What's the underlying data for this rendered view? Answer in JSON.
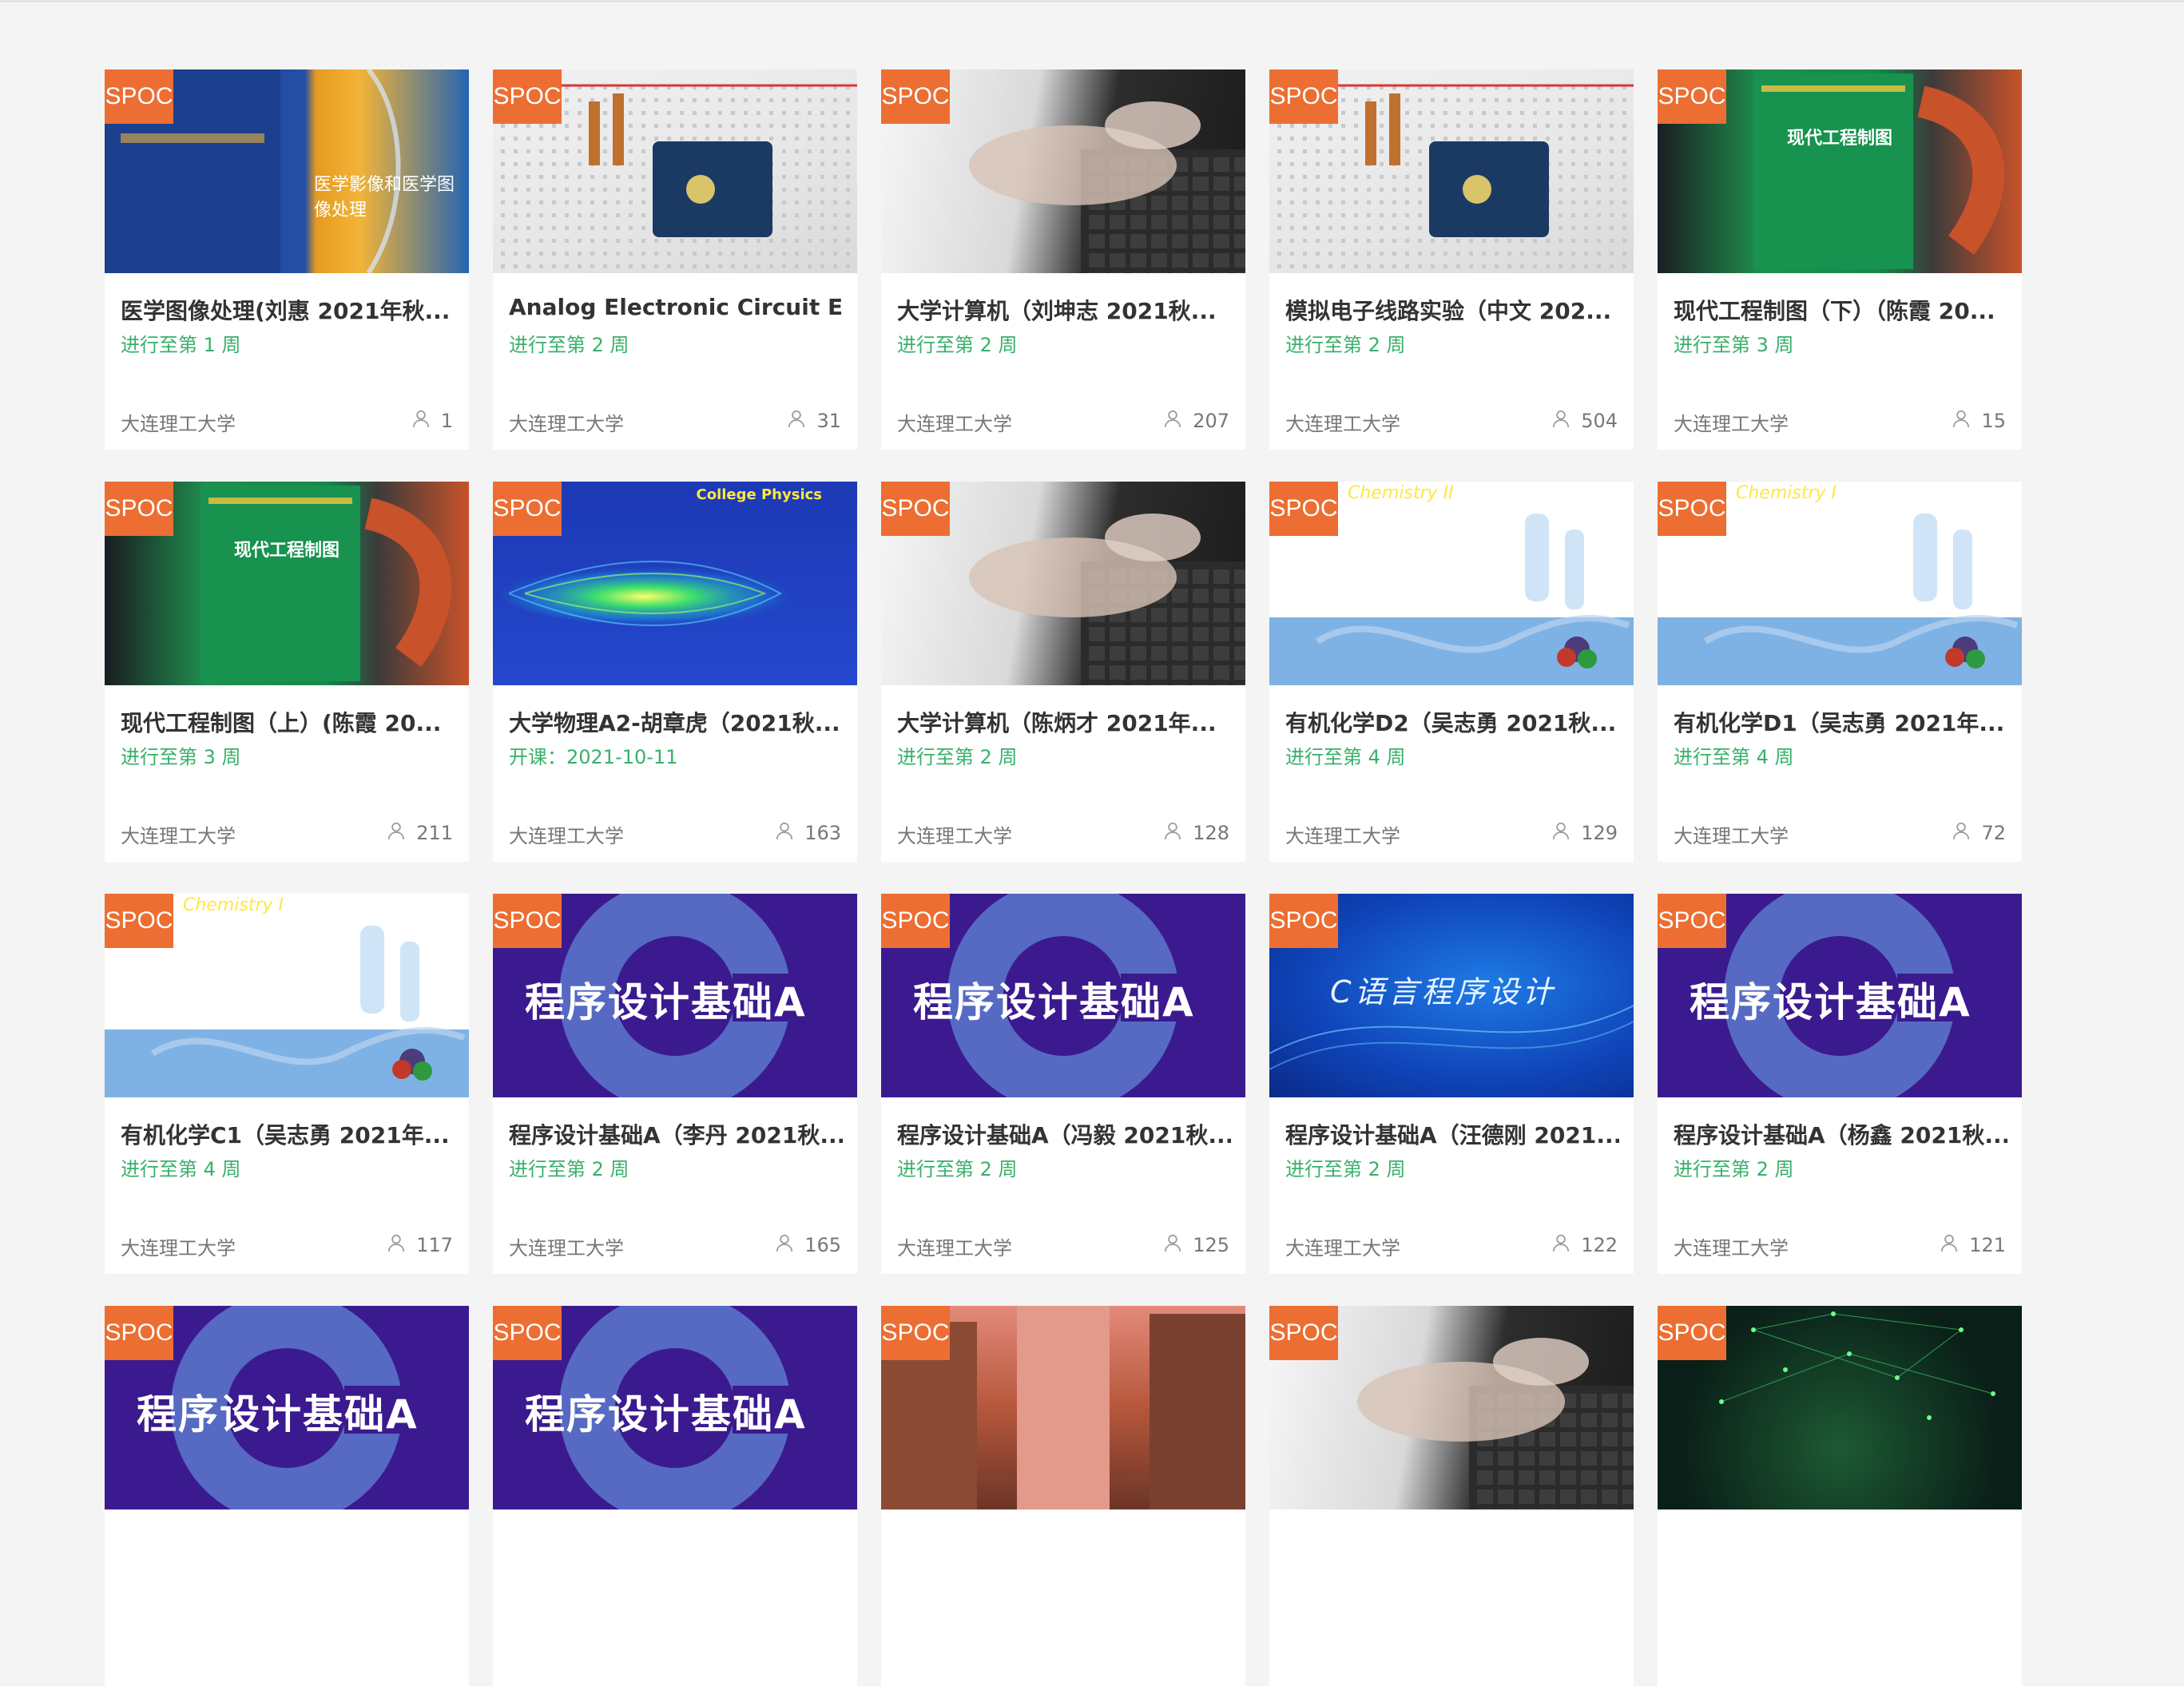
{
  "badge_label": "SPOC",
  "thumb_texts": {
    "physics": "College Physics",
    "chem2": "Chemistry II",
    "chem1": "Chemistry I",
    "cprog": "程序设计基础A",
    "clang": "C语言程序设计",
    "drawing": "现代工程制图",
    "medical": "医学影像和医学图像处理"
  },
  "rows": [
    {
      "cards": [
        {
          "title": "医学图像处理(刘惠 2021年秋...",
          "progress": "进行至第 1 周",
          "school": "大连理工大学",
          "count": "1",
          "theme": "medical"
        },
        {
          "title": "Analog Electronic Circuit E...",
          "progress": "进行至第 2 周",
          "school": "大连理工大学",
          "count": "31",
          "theme": "breadboard"
        },
        {
          "title": "大学计算机（刘坤志 2021秋...",
          "progress": "进行至第 2 周",
          "school": "大连理工大学",
          "count": "207",
          "theme": "keyboard"
        },
        {
          "title": "模拟电子线路实验（中文 202...",
          "progress": "进行至第 2 周",
          "school": "大连理工大学",
          "count": "504",
          "theme": "breadboard"
        },
        {
          "title": "现代工程制图（下）（陈霞 20...",
          "progress": "进行至第 3 周",
          "school": "大连理工大学",
          "count": "15",
          "theme": "drawing"
        }
      ]
    },
    {
      "cards": [
        {
          "title": "现代工程制图（上）(陈霞 20...",
          "progress": "进行至第 3 周",
          "school": "大连理工大学",
          "count": "211",
          "theme": "drawing"
        },
        {
          "title": "大学物理A2-胡章虎（2021秋...",
          "progress": "开课：2021-10-11",
          "school": "大连理工大学",
          "count": "163",
          "theme": "physics"
        },
        {
          "title": "大学计算机（陈炳才 2021年...",
          "progress": "进行至第 2 周",
          "school": "大连理工大学",
          "count": "128",
          "theme": "keyboard"
        },
        {
          "title": "有机化学D2（吴志勇 2021秋...",
          "progress": "进行至第 4 周",
          "school": "大连理工大学",
          "count": "129",
          "theme": "chem2"
        },
        {
          "title": "有机化学D1（吴志勇 2021年...",
          "progress": "进行至第 4 周",
          "school": "大连理工大学",
          "count": "72",
          "theme": "chem1"
        }
      ]
    },
    {
      "cards": [
        {
          "title": "有机化学C1（吴志勇 2021年...",
          "progress": "进行至第 4 周",
          "school": "大连理工大学",
          "count": "117",
          "theme": "chem1"
        },
        {
          "title": "程序设计基础A（李丹 2021秋...",
          "progress": "进行至第 2 周",
          "school": "大连理工大学",
          "count": "165",
          "theme": "cprog"
        },
        {
          "title": "程序设计基础A（冯毅 2021秋...",
          "progress": "进行至第 2 周",
          "school": "大连理工大学",
          "count": "125",
          "theme": "cprog"
        },
        {
          "title": "程序设计基础A（汪德刚 2021...",
          "progress": "进行至第 2 周",
          "school": "大连理工大学",
          "count": "122",
          "theme": "clang"
        },
        {
          "title": "程序设计基础A（杨鑫 2021秋...",
          "progress": "进行至第 2 周",
          "school": "大连理工大学",
          "count": "121",
          "theme": "cprog"
        }
      ]
    },
    {
      "cards": [
        {
          "title": "",
          "progress": "",
          "school": "",
          "count": "",
          "theme": "cprog"
        },
        {
          "title": "",
          "progress": "",
          "school": "",
          "count": "",
          "theme": "cprog"
        },
        {
          "title": "",
          "progress": "",
          "school": "",
          "count": "",
          "theme": "street"
        },
        {
          "title": "",
          "progress": "",
          "school": "",
          "count": "",
          "theme": "keyboard"
        },
        {
          "title": "",
          "progress": "",
          "school": "",
          "count": "",
          "theme": "network"
        }
      ]
    }
  ]
}
